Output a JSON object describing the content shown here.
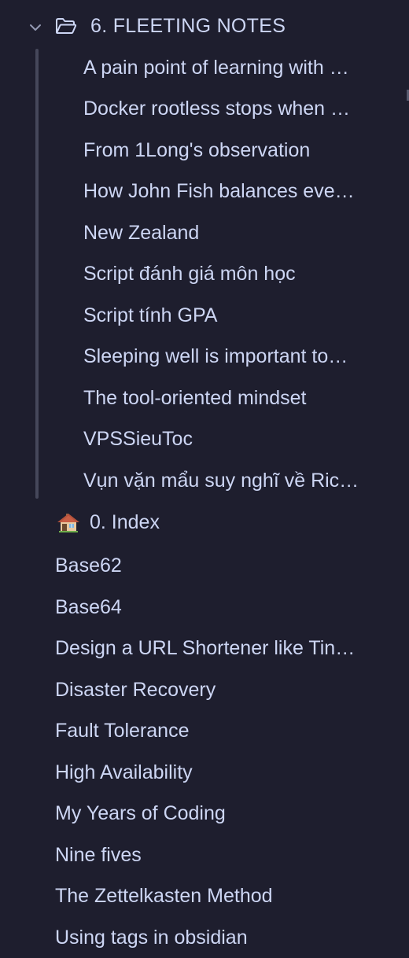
{
  "folder": {
    "label": "6. FLEETING NOTES",
    "children": [
      "A pain point of learning with …",
      "Docker rootless stops when …",
      "From 1Long's observation",
      "How John Fish balances eve…",
      "New Zealand",
      "Script đánh giá môn học",
      "Script tính GPA",
      "Sleeping well is important to…",
      "The tool-oriented mindset",
      "VPSSieuToc",
      "Vụn vặn mẩu suy nghĩ về Ric…"
    ]
  },
  "index_item": {
    "label": "0. Index",
    "icon": "house-icon"
  },
  "root_items": [
    "Base62",
    "Base64",
    "Design a URL Shortener like Tin…",
    "Disaster Recovery",
    "Fault Tolerance",
    "High Availability",
    "My Years of Coding",
    "Nine fives",
    "The Zettelkasten Method",
    "Using tags in obsidian"
  ],
  "colors": {
    "background": "#1e1e2e",
    "text": "#cdd6f4",
    "indent_guide": "#45475a"
  }
}
